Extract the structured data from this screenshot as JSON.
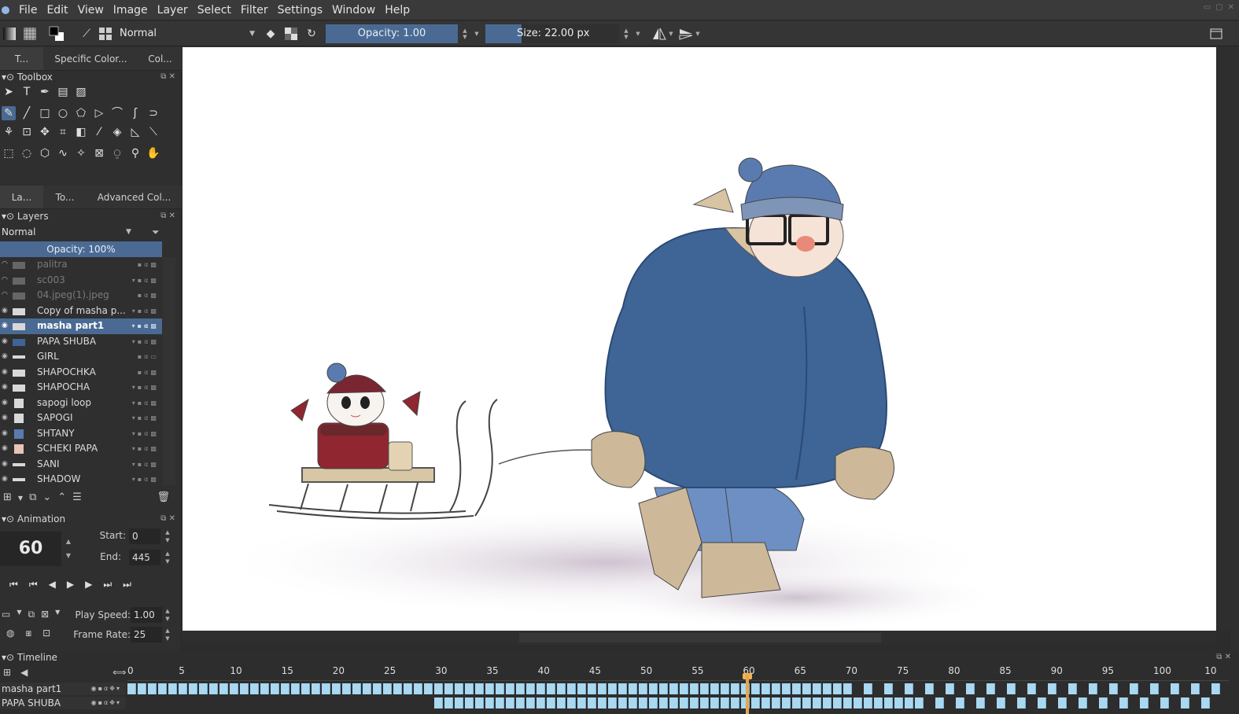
{
  "menubar": {
    "items": [
      "File",
      "Edit",
      "View",
      "Image",
      "Layer",
      "Select",
      "Filter",
      "Settings",
      "Window",
      "Help"
    ]
  },
  "toolbar": {
    "blend_mode": "Normal",
    "opacity_label": "Opacity:  1.00",
    "size_label": "Size:  22.00 px"
  },
  "top_tabs": [
    "T...",
    "Specific Color...",
    "Col..."
  ],
  "toolbox": {
    "title": "Toolbox",
    "rows": [
      [
        "select-shape-icon",
        "text-icon",
        "calligraphy-icon",
        "edit-shapes-icon",
        "pattern-icon"
      ],
      [
        "freehand-brush-icon",
        "line-icon",
        "rectangle-icon",
        "ellipse-icon",
        "polygon-icon",
        "polyline-icon",
        "bezier-icon",
        "freehand-path-icon",
        "dynamic-brush-icon"
      ],
      [
        "multibrush-icon",
        "transform-icon",
        "move-icon",
        "crop-icon",
        "gradient-icon",
        "color-picker-icon",
        "fill-icon",
        "assistant-icon",
        "measure-icon"
      ],
      [
        "rect-select-icon",
        "ellipse-select-icon",
        "polygon-select-icon",
        "freehand-select-icon",
        "contiguous-select-icon",
        "similar-select-icon",
        "bezier-select-icon",
        "zoom-icon",
        "pan-icon"
      ]
    ]
  },
  "mid_tabs": [
    "La...",
    "To...",
    "Advanced Col..."
  ],
  "layers": {
    "title": "Layers",
    "blend_mode": "Normal",
    "opacity_label": "Opacity:  100%",
    "items": [
      {
        "name": "palitra",
        "visible": false,
        "selected": false
      },
      {
        "name": "sc003",
        "visible": false,
        "selected": false
      },
      {
        "name": "04.jpeg(1).jpeg",
        "visible": false,
        "selected": false
      },
      {
        "name": "Copy of masha p...",
        "visible": true,
        "selected": false
      },
      {
        "name": "masha part1",
        "visible": true,
        "selected": true
      },
      {
        "name": "PAPA SHUBA",
        "visible": true,
        "selected": false
      },
      {
        "name": "GIRL",
        "visible": true,
        "selected": false
      },
      {
        "name": "SHAPOCHKA",
        "visible": true,
        "selected": false
      },
      {
        "name": "SHAPOCHA",
        "visible": true,
        "selected": false
      },
      {
        "name": "sapogi loop",
        "visible": true,
        "selected": false
      },
      {
        "name": "SAPOGI",
        "visible": true,
        "selected": false
      },
      {
        "name": "SHTANY",
        "visible": true,
        "selected": false
      },
      {
        "name": "SCHEKI PAPA",
        "visible": true,
        "selected": false
      },
      {
        "name": "SANI",
        "visible": true,
        "selected": false
      },
      {
        "name": "SHADOW",
        "visible": true,
        "selected": false
      }
    ]
  },
  "animation": {
    "title": "Animation",
    "current_frame": "60",
    "start_label": "Start:",
    "start_value": "0",
    "end_label": "End:",
    "end_value": "445",
    "play_speed_label": "Play Speed:",
    "play_speed_value": "1.00",
    "frame_rate_label": "Frame Rate:",
    "frame_rate_value": "25"
  },
  "timeline": {
    "title": "Timeline",
    "ticks": [
      "0",
      "5",
      "10",
      "15",
      "20",
      "25",
      "30",
      "35",
      "40",
      "45",
      "50",
      "55",
      "60",
      "65",
      "70",
      "75",
      "80",
      "85",
      "90",
      "95",
      "100",
      "10"
    ],
    "tracks": [
      {
        "name": "masha part1"
      },
      {
        "name": "PAPA SHUBA"
      }
    ]
  },
  "colors": {
    "accent": "#4a6a93",
    "panel": "#2f2f2f",
    "frame_cell": "#a9d8f0",
    "playhead": "#e7a54b",
    "coat": "#3f6496",
    "hat": "#5a7bb0",
    "mitten": "#cdb99a"
  }
}
